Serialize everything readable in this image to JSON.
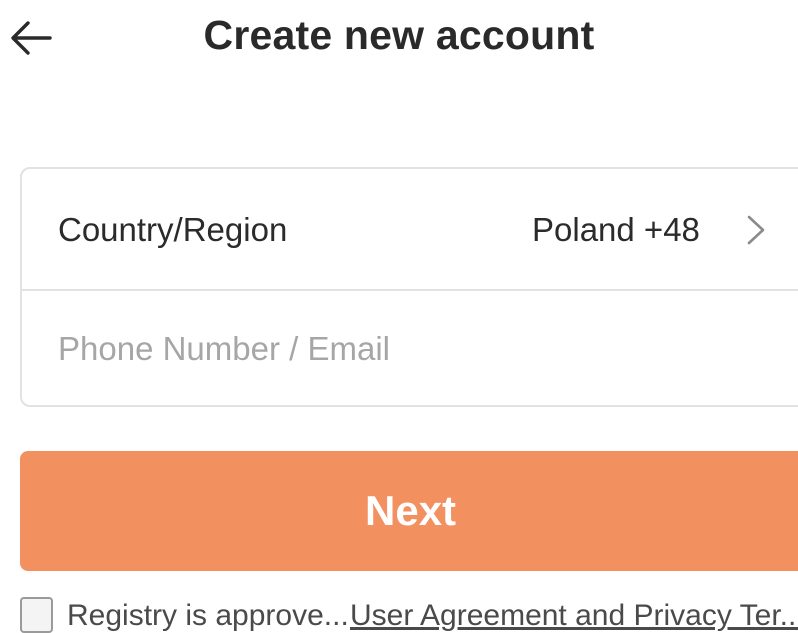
{
  "header": {
    "back_icon": "arrow-left-icon",
    "title": "Create new account"
  },
  "form": {
    "country_label": "Country/Region",
    "country_value": "Poland +48",
    "country_chevron_icon": "chevron-right-icon",
    "phone_placeholder": "Phone Number / Email",
    "phone_value": ""
  },
  "next_button": {
    "label": "Next",
    "color": "#f29060"
  },
  "agreement": {
    "checked": false,
    "text": "Registry is approve...",
    "link_text": "User Agreement and Privacy Ter..."
  }
}
